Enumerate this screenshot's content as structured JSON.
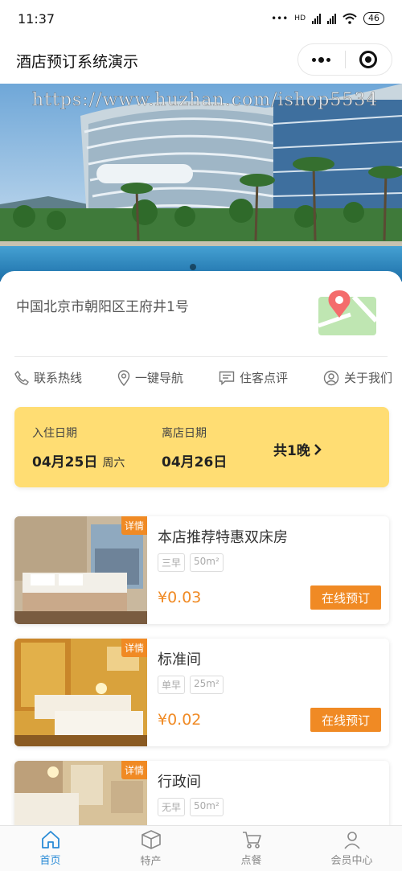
{
  "status": {
    "time": "11:37",
    "network": "HD",
    "battery": "46"
  },
  "nav": {
    "title": "酒店预订系统演示"
  },
  "banner": {
    "watermark": "https://www.huzhan.com/ishop5534"
  },
  "hotel": {
    "address": "中国北京市朝阳区王府井1号",
    "actions": [
      {
        "label": "联系热线",
        "icon": "phone-icon"
      },
      {
        "label": "一键导航",
        "icon": "location-icon"
      },
      {
        "label": "住客点评",
        "icon": "comment-icon"
      },
      {
        "label": "关于我们",
        "icon": "user-icon"
      }
    ]
  },
  "dates": {
    "checkin_label": "入住日期",
    "checkin_date": "04月25日",
    "checkin_week": "周六",
    "checkout_label": "离店日期",
    "checkout_date": "04月26日",
    "nights": "共1晚"
  },
  "rooms": [
    {
      "name": "本店推荐特惠双床房",
      "tag_detail": "详情",
      "breakfast": "三早",
      "area": "50m²",
      "price": "¥0.03",
      "button": "在线预订"
    },
    {
      "name": "标准间",
      "tag_detail": "详情",
      "breakfast": "单早",
      "area": "25m²",
      "price": "¥0.02",
      "button": "在线预订"
    },
    {
      "name": "行政间",
      "tag_detail": "详情",
      "breakfast": "无早",
      "area": "50m²"
    }
  ],
  "tabs": [
    {
      "label": "首页",
      "icon": "home-icon",
      "active": true
    },
    {
      "label": "特产",
      "icon": "box-icon",
      "active": false
    },
    {
      "label": "点餐",
      "icon": "cart-icon",
      "active": false
    },
    {
      "label": "会员中心",
      "icon": "person-icon",
      "active": false
    }
  ],
  "colors": {
    "accent": "#f08a24",
    "date_card": "#ffdd73",
    "tab_active": "#2a8bd6"
  }
}
